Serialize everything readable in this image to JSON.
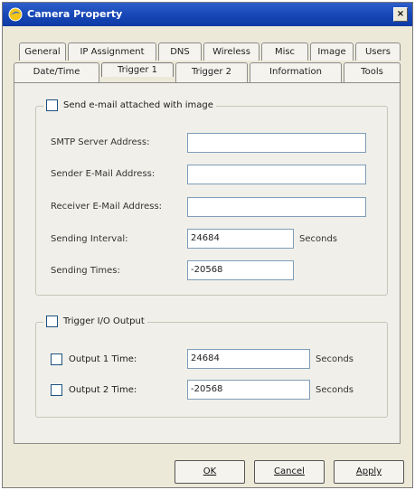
{
  "window": {
    "title": "Camera Property",
    "close_label": "×"
  },
  "tabs": {
    "row1": [
      "General",
      "IP Assignment",
      "DNS",
      "Wireless",
      "Misc",
      "Image",
      "Users"
    ],
    "row2": [
      "Date/Time",
      "Trigger 1",
      "Trigger 2",
      "Information",
      "Tools"
    ],
    "active": "Trigger 1"
  },
  "email": {
    "legend": "Send e-mail attached with image",
    "checked": false,
    "smtp_label": "SMTP Server Address:",
    "smtp_value": "",
    "sender_label": "Sender E-Mail Address:",
    "sender_value": "",
    "receiver_label": "Receiver E-Mail Address:",
    "receiver_value": "",
    "interval_label": "Sending Interval:",
    "interval_value": "24684",
    "interval_unit": "Seconds",
    "times_label": "Sending Times:",
    "times_value": "-20568"
  },
  "io": {
    "legend": "Trigger I/O Output",
    "checked": false,
    "out1_label": "Output 1 Time:",
    "out1_value": "24684",
    "out1_unit": "Seconds",
    "out2_label": "Output 2 Time:",
    "out2_value": "-20568",
    "out2_unit": "Seconds"
  },
  "buttons": {
    "ok": "OK",
    "cancel": "Cancel",
    "apply": "Apply"
  }
}
